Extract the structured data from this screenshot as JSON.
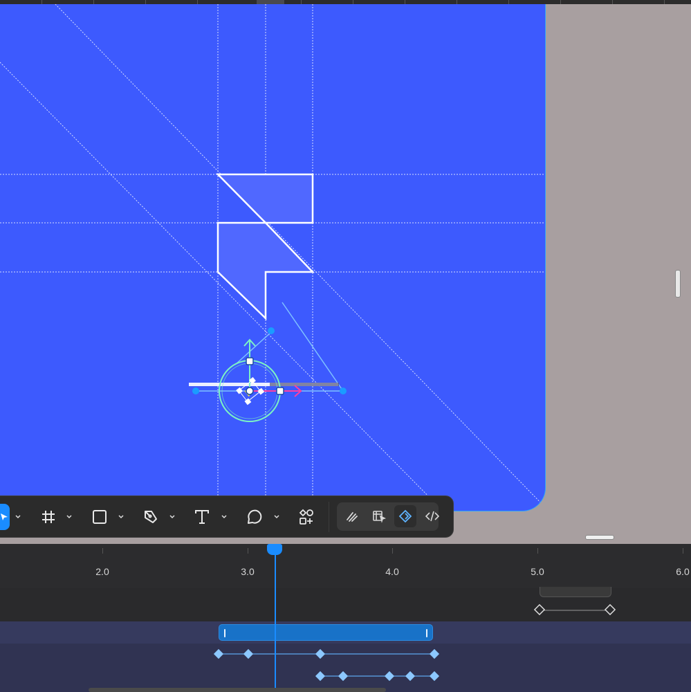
{
  "toolbar": {
    "tools": [
      {
        "name": "select-tool",
        "icon": "pointer-icon"
      },
      {
        "name": "frame-tool",
        "icon": "hash-icon"
      },
      {
        "name": "shape-tool",
        "icon": "square-icon"
      },
      {
        "name": "pen-tool",
        "icon": "pen-icon"
      },
      {
        "name": "text-tool",
        "icon": "text-icon"
      },
      {
        "name": "comment-tool",
        "icon": "speech-bubble-icon"
      },
      {
        "name": "components-tool",
        "icon": "components-icon"
      }
    ],
    "modes": [
      {
        "name": "draw-mode",
        "icon": "scribble-icon"
      },
      {
        "name": "design-mode",
        "icon": "design-icon"
      },
      {
        "name": "animate-mode",
        "icon": "diamond-keyframe-icon",
        "active": true
      },
      {
        "name": "code-mode",
        "icon": "code-icon"
      }
    ]
  },
  "timeline": {
    "ticks": [
      "2.0",
      "3.0",
      "4.0",
      "5.0",
      "6.0"
    ],
    "playhead_seconds": 3.19
  },
  "colors": {
    "artboard": "#3d5afe",
    "canvas_bg": "#a89fa0",
    "accent": "#1a8cff",
    "keyframe": "#7ec1ff",
    "clip": "#1872c8"
  }
}
